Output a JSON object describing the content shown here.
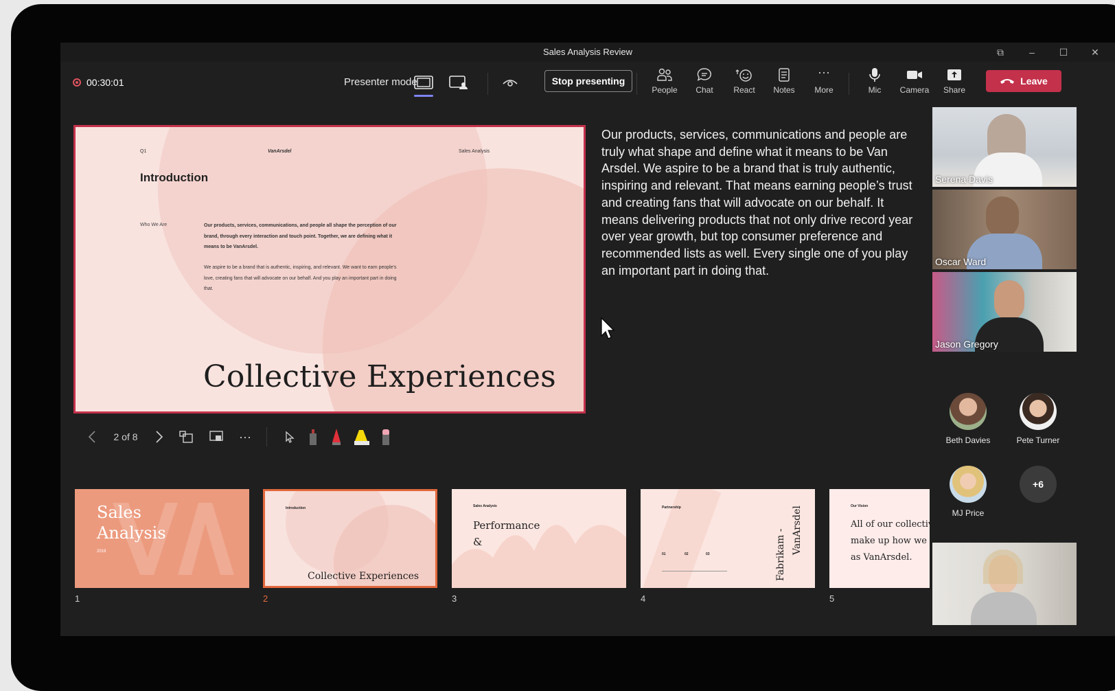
{
  "window": {
    "title": "Sales Analysis Review"
  },
  "toolbar": {
    "timer": "00:30:01",
    "presenter_mode_label": "Presenter mode",
    "stop_presenting_label": "Stop presenting",
    "people_label": "People",
    "chat_label": "Chat",
    "react_label": "React",
    "notes_label": "Notes",
    "more_label": "More",
    "mic_label": "Mic",
    "camera_label": "Camera",
    "share_label": "Share",
    "leave_label": "Leave"
  },
  "slide": {
    "q_label": "Q1",
    "logo": "VanArsdel",
    "tag": "Sales Analysis",
    "heading": "Introduction",
    "who_label": "Who We Are",
    "paragraph1": "Our products, services, communications, and people all shape the perception of our brand, through every interaction and touch point. Together, we are defining what it means to be VanArsdel.",
    "paragraph2": "We aspire to be a brand that is authentic, inspiring, and relevant. We want to earn people's love, creating fans that will advocate on our behalf. And you play an important part in doing that.",
    "big_title": "Collective Experiences"
  },
  "notes": "Our products, services, communications and people are truly what shape and define what it means to be Van Arsdel. We aspire to be a brand that is truly authentic, inspiring and relevant. That means earning people’s trust and creating fans that will advocate on our behalf. It means delivering products that not only drive record year over year growth, but top consumer preference and recommended lists as well. Every single one of you play an important part in doing that.",
  "slide_nav": {
    "counter": "2 of 8"
  },
  "thumbnails": [
    {
      "number": "1",
      "title_line1": "Sales",
      "title_line2": "Analysis",
      "year": "2019"
    },
    {
      "number": "2",
      "heading": "Introduction",
      "title": "Collective Experiences"
    },
    {
      "number": "3",
      "heading": "Sales Analysis",
      "title_line1": "Performance",
      "title_line2": "&"
    },
    {
      "number": "4",
      "heading": "Partnership",
      "labels": [
        "01",
        "02",
        "03"
      ],
      "vertical1": "Fabrikam -",
      "vertical2": "VanArsdel"
    },
    {
      "number": "5",
      "heading": "Our Vision",
      "line1": "All of our collective",
      "line2": "make up how we co",
      "line3": "as VanArsdel."
    }
  ],
  "participants": {
    "video": [
      {
        "name": "Serena Davis"
      },
      {
        "name": "Oscar Ward"
      },
      {
        "name": "Jason Gregory"
      }
    ],
    "avatars": [
      {
        "name": "Beth Davies"
      },
      {
        "name": "Pete Turner"
      },
      {
        "name": "MJ Price"
      }
    ],
    "overflow": "+6"
  }
}
